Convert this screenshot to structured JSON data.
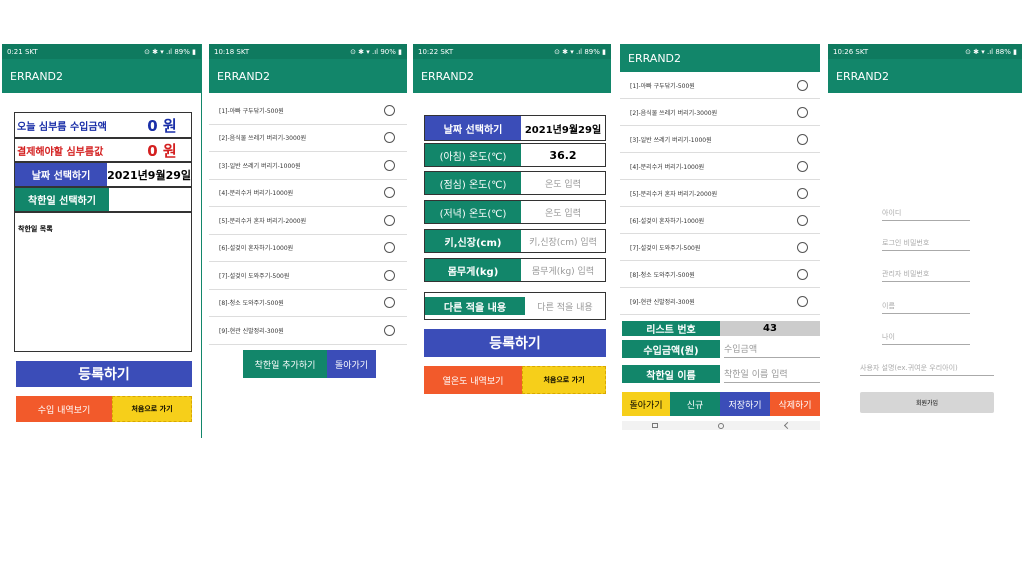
{
  "app_title": "ERRAND2",
  "screen1": {
    "status_time": "0:21 SKT",
    "status_right": "⊙ ✱ ▾ .ıl 89% ▮",
    "income_label": "오늘 심부름 수입금액",
    "income_value": "0 원",
    "pay_label": "결제해야할 심부름값",
    "pay_value": "0 원",
    "date_button": "날짜 선택하기",
    "date_value": "2021년9월29일",
    "good_button": "착한일 선택하기",
    "good_list_label": "착한일 목록",
    "register_button": "등록하기",
    "income_history_button": "수입 내역보기",
    "home_button": "처음으로 가기"
  },
  "screen2": {
    "status_time": "10:18 SKT",
    "status_right": "⊙ ✱ ▾ .ıl 90% ▮",
    "items": [
      "[1]-아빠 구두닦기-500원",
      "[2]-음식물 쓰레기 버리기-3000원",
      "[3]-일반 쓰레기 버리기-1000원",
      "[4]-분리수거 버리기-1000원",
      "[5]-분리수거 혼자 버리기-2000원",
      "[6]-설겆이 혼자하기-1000원",
      "[7]-설겆이 도와주기-500원",
      "[8]-청소 도와주기-500원",
      "[9]-현관 신발정리-300원"
    ],
    "add_button": "착한일 추가하기",
    "back_button": "돌아가기"
  },
  "screen3": {
    "status_time": "10:22 SKT",
    "status_right": "⊙ ✱ ▾ .ıl 89% ▮",
    "date_button": "날짜 선택하기",
    "date_value": "2021년9월29일",
    "morning_label": "(아침) 온도(℃)",
    "morning_value": "36.2",
    "lunch_label": "(점심) 온도(℃)",
    "lunch_placeholder": "온도 입력",
    "evening_label": "(저녁) 온도(℃)",
    "evening_placeholder": "온도 입력",
    "height_label": "키,신장(cm)",
    "height_placeholder": "키,신장(cm) 입력",
    "weight_label": "몸무게(kg)",
    "weight_placeholder": "몸무게(kg) 입력",
    "other_label": "다른 적을 내용",
    "other_placeholder": "다른 적을 내용",
    "register_button": "등록하기",
    "fever_history_button": "열온도 내역보기",
    "home_button": "처음으로 가기"
  },
  "screen4": {
    "items": [
      "[1]-아빠 구두닦기-500원",
      "[2]-음식물 쓰레기 버리기-3000원",
      "[3]-일반 쓰레기 버리기-1000원",
      "[4]-분리수거 버리기-1000원",
      "[5]-분리수거 혼자 버리기-2000원",
      "[6]-설겆이 혼자하기-1000원",
      "[7]-설겆이 도와주기-500원",
      "[8]-청소 도와주기-500원",
      "[9]-현관 신발정리-300원"
    ],
    "list_no_label": "리스트 번호",
    "list_no_value": "43",
    "income_label": "수입금액(원)",
    "income_placeholder": "수입금액",
    "good_name_label": "착한일 이름",
    "good_name_placeholder": "착한일 이름 입력",
    "back_button": "돌아가기",
    "new_button": "신규",
    "save_button": "저장하기",
    "delete_button": "삭제하기"
  },
  "screen5": {
    "status_time": "10:26 SKT",
    "status_right": "⊙ ✱ ▾ .ıl 88% ▮",
    "id_placeholder": "아이디",
    "login_pw_placeholder": "로그인 비밀번호",
    "admin_pw_placeholder": "관리자 비밀번호",
    "name_placeholder": "이름",
    "age_placeholder": "나이",
    "desc_placeholder": "사용자 설명(ex.귀여운 우리아이)",
    "signup_button": "회원가입"
  }
}
